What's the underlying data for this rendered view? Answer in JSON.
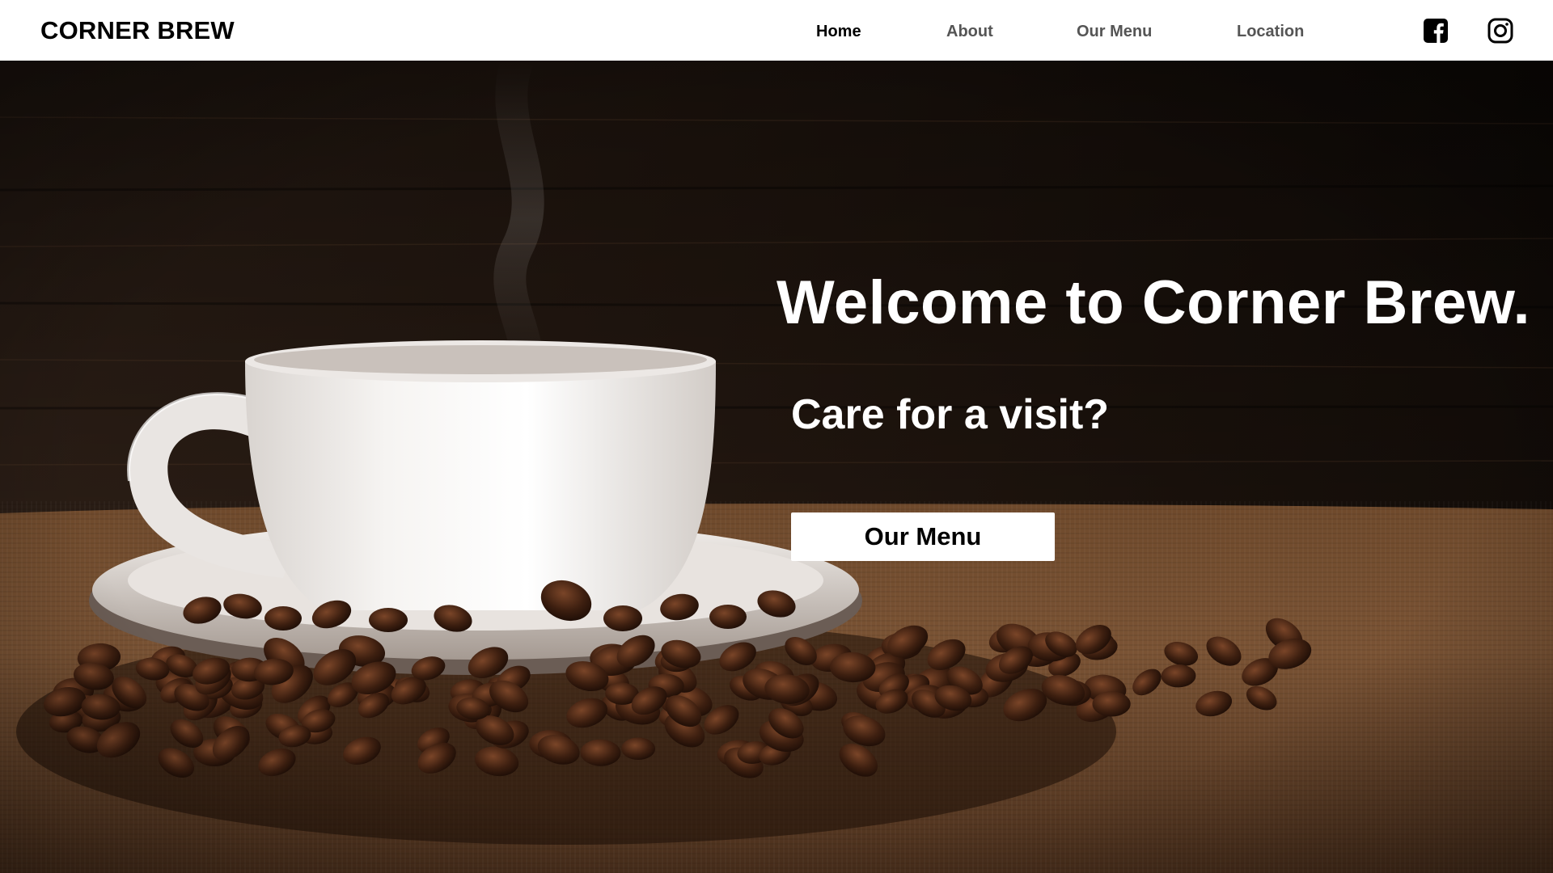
{
  "brand": {
    "name": "CORNER BREW"
  },
  "nav": {
    "items": [
      {
        "label": "Home",
        "active": true
      },
      {
        "label": "About",
        "active": false
      },
      {
        "label": "Our Menu",
        "active": false
      },
      {
        "label": "Location",
        "active": false
      }
    ],
    "social": [
      {
        "icon": "facebook-icon"
      },
      {
        "icon": "instagram-icon"
      }
    ]
  },
  "hero": {
    "headline": "Welcome to Corner Brew.",
    "subheadline": "Care for a visit?",
    "cta_label": "Our Menu",
    "image_subject": "coffee-cup-with-beans"
  },
  "colors": {
    "nav_bg": "#ffffff",
    "nav_active": "#000000",
    "nav_inactive": "#555555",
    "hero_text": "#ffffff",
    "cta_bg": "#ffffff"
  }
}
